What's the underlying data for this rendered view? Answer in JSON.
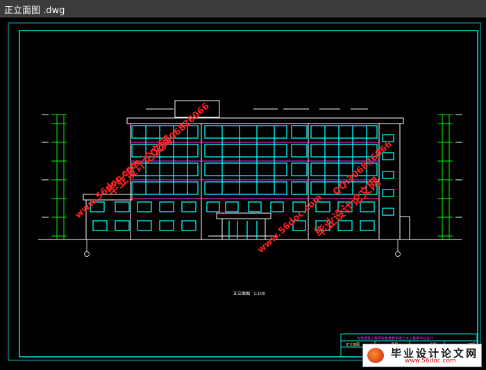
{
  "window": {
    "title": "正立面图 .dwg"
  },
  "drawing": {
    "caption": "正立面图",
    "caption_scale": "1:100",
    "title_block_heading": "吉林建筑工程学院某某教学楼土木工程系毕业设计",
    "title_block_cells": [
      "正立面图",
      "图号",
      "比例",
      "日期"
    ]
  },
  "watermarks": {
    "site": "www.56doc.com",
    "brand": "毕业设计论文网",
    "qq": "QQ:306826066"
  },
  "colors": {
    "background": "#000000",
    "frame": "#00e5e5",
    "windows": "#00ffff",
    "floor_lines": "#ff33ff",
    "dimension": "#00ff00",
    "watermark": "#ff2020"
  }
}
